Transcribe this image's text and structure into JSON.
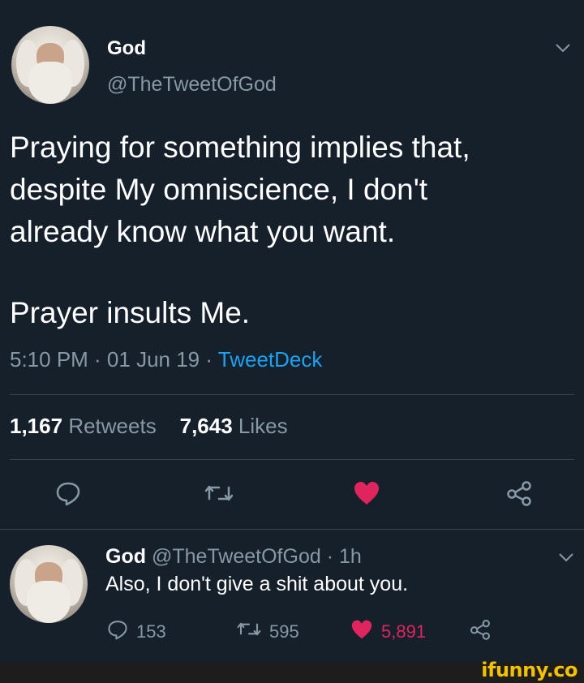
{
  "tweet": {
    "author_name": "God",
    "author_handle": "@TheTweetOfGod",
    "text_lines": [
      "Praying for something implies that,",
      "despite My omniscience, I don't",
      "already know what you want."
    ],
    "text_second": "Prayer insults Me.",
    "time": "5:10 PM · 01 Jun 19 · ",
    "source": "TweetDeck",
    "retweets_count": "1,167",
    "retweets_label": "Retweets",
    "likes_count": "7,643",
    "likes_label": "Likes"
  },
  "reply": {
    "author_name": "God",
    "handle_time": "@TheTweetOfGod · 1h",
    "text": "Also, I don't give a shit about you.",
    "replies": "153",
    "retweets": "595",
    "likes": "5,891"
  },
  "icons": {
    "reply": "speech-bubble-icon",
    "retweet": "retweet-icon",
    "like": "heart-icon",
    "share": "share-icon",
    "more": "chevron-down-icon"
  },
  "colors": {
    "background": "#15202b",
    "like_red": "#e0245e",
    "link_blue": "#1da1f2",
    "muted": "#8899a6"
  },
  "watermark": "ifunny.co"
}
